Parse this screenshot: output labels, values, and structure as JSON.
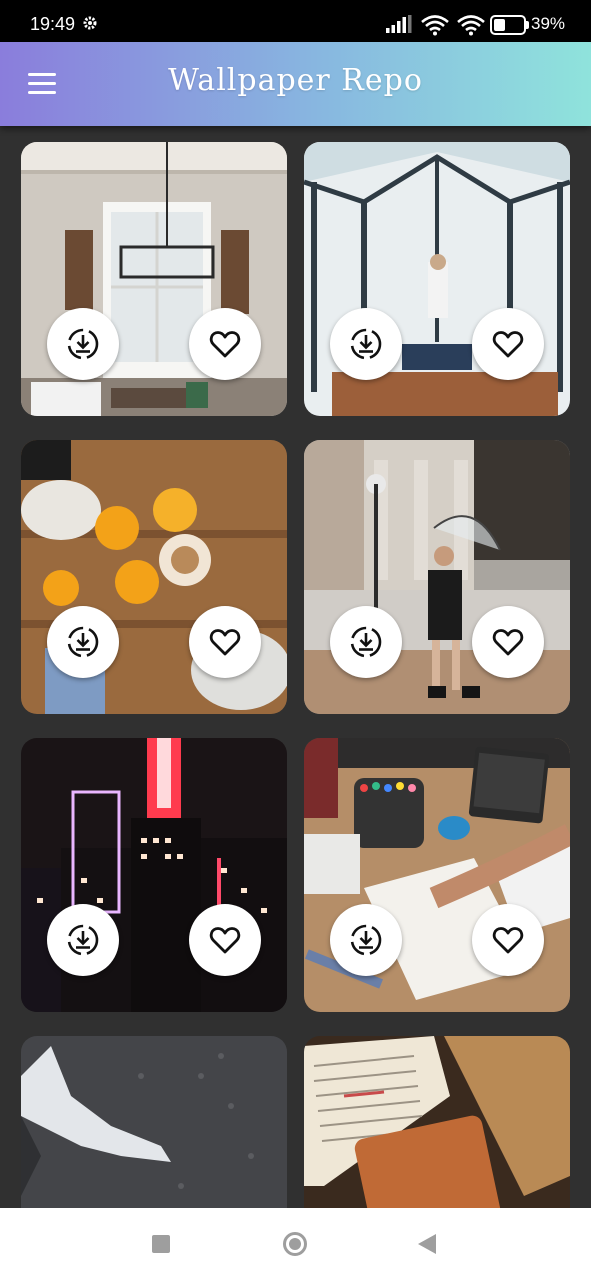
{
  "status_bar": {
    "time": "19:49",
    "battery_percent": "39%",
    "battery_level": 0.39,
    "icons": [
      "gear-icon",
      "signal-icon",
      "wifi-icon",
      "wifi-icon",
      "battery-icon"
    ]
  },
  "app_bar": {
    "title": "Wallpaper Repo",
    "menu_icon": "hamburger-menu-icon",
    "gradient_start": "#8a7ddc",
    "gradient_end": "#8fe3dc"
  },
  "wallpapers": [
    {
      "subject": "dining-room",
      "actions": [
        "download-icon",
        "heart-icon"
      ]
    },
    {
      "subject": "glass-sunroom",
      "actions": [
        "download-icon",
        "heart-icon"
      ]
    },
    {
      "subject": "orange-juice-toast",
      "actions": [
        "download-icon",
        "heart-icon"
      ]
    },
    {
      "subject": "girl-with-umbrella",
      "actions": [
        "download-icon",
        "heart-icon"
      ]
    },
    {
      "subject": "neon-city",
      "actions": [
        "download-icon",
        "heart-icon"
      ]
    },
    {
      "subject": "architect-desk",
      "actions": [
        "download-icon",
        "heart-icon"
      ]
    },
    {
      "subject": "gray-gravel",
      "actions": []
    },
    {
      "subject": "open-bible",
      "actions": []
    }
  ],
  "nav_bar": {
    "icons": [
      "recents-icon",
      "home-icon",
      "back-icon"
    ]
  },
  "colors": {
    "background": "#303030",
    "card_button": "#ffffff",
    "icon": "#000000"
  }
}
